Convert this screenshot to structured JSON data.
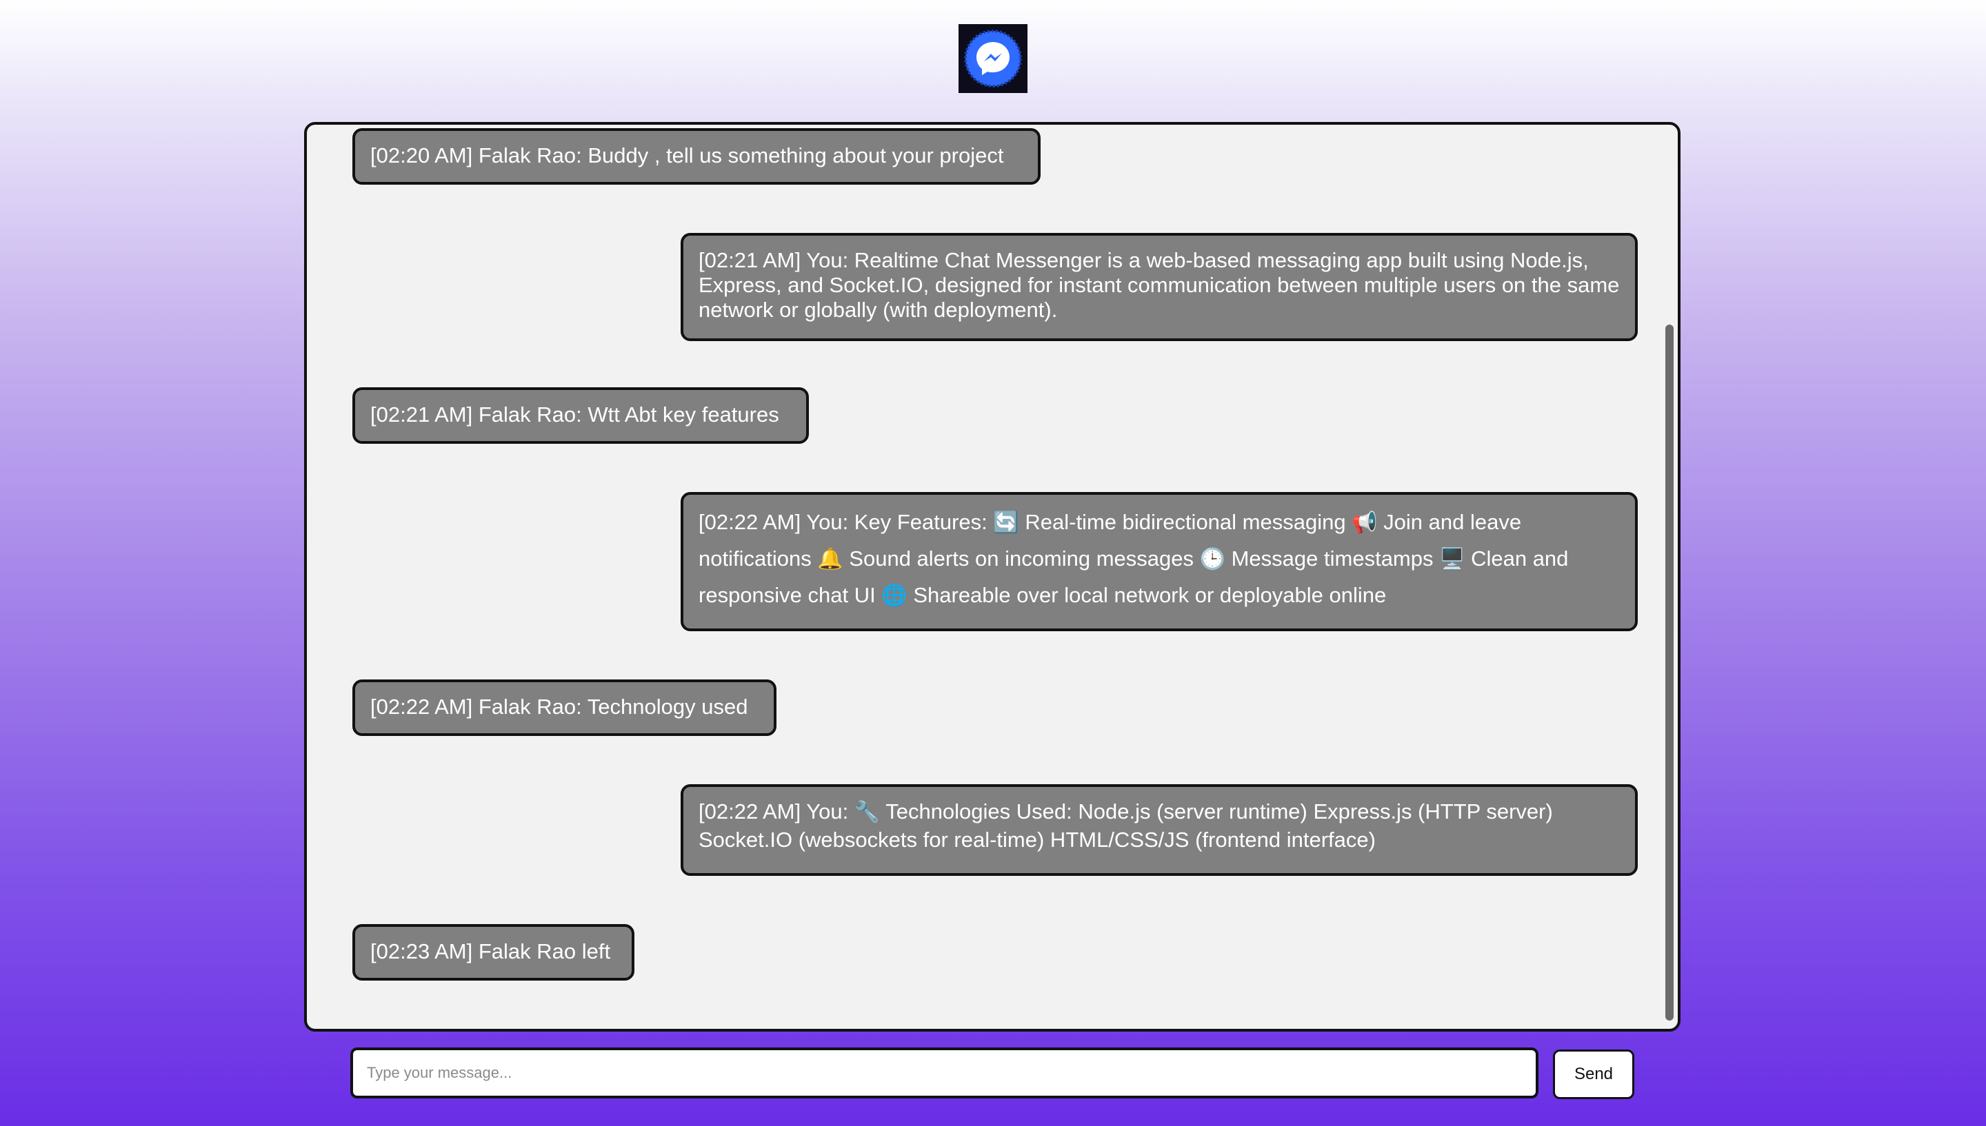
{
  "header": {
    "logo_icon": "messenger-icon",
    "logo_color": "#2f6bff"
  },
  "messages": [
    {
      "text": "[02:20 AM] Falak Rao: Buddy , tell us something about your project",
      "side": "left"
    },
    {
      "text": "[02:21 AM] You: Realtime Chat Messenger is a web-based messaging app built using Node.js, Express, and Socket.IO, designed for instant communication between multiple users on the same network or globally (with deployment).",
      "side": "right"
    },
    {
      "text": "[02:21 AM] Falak Rao: Wtt Abt key features",
      "side": "left"
    },
    {
      "text_parts": [
        "[02:22 AM] You: Key Features: ",
        "🔄",
        " Real-time bidirectional messaging ",
        "📢",
        " Join and leave notifications ",
        "🔔",
        " Sound alerts on incoming messages ",
        "🕒",
        " Message timestamps ",
        "🖥️",
        " Clean and responsive chat UI ",
        "🌐",
        " Shareable over local network or deployable online"
      ],
      "side": "right"
    },
    {
      "text": "[02:22 AM] Falak Rao: Technology used",
      "side": "left"
    },
    {
      "text_parts": [
        "[02:22 AM] You: ",
        "🔧",
        " Technologies Used: Node.js (server runtime) Express.js (HTTP server) Socket.IO (websockets for real-time) HTML/CSS/JS (frontend interface)"
      ],
      "side": "right"
    },
    {
      "text": "[02:23 AM] Falak Rao left",
      "side": "left"
    }
  ],
  "composer": {
    "placeholder": "Type your message...",
    "value": ""
  },
  "send_button": {
    "label": "Send"
  }
}
